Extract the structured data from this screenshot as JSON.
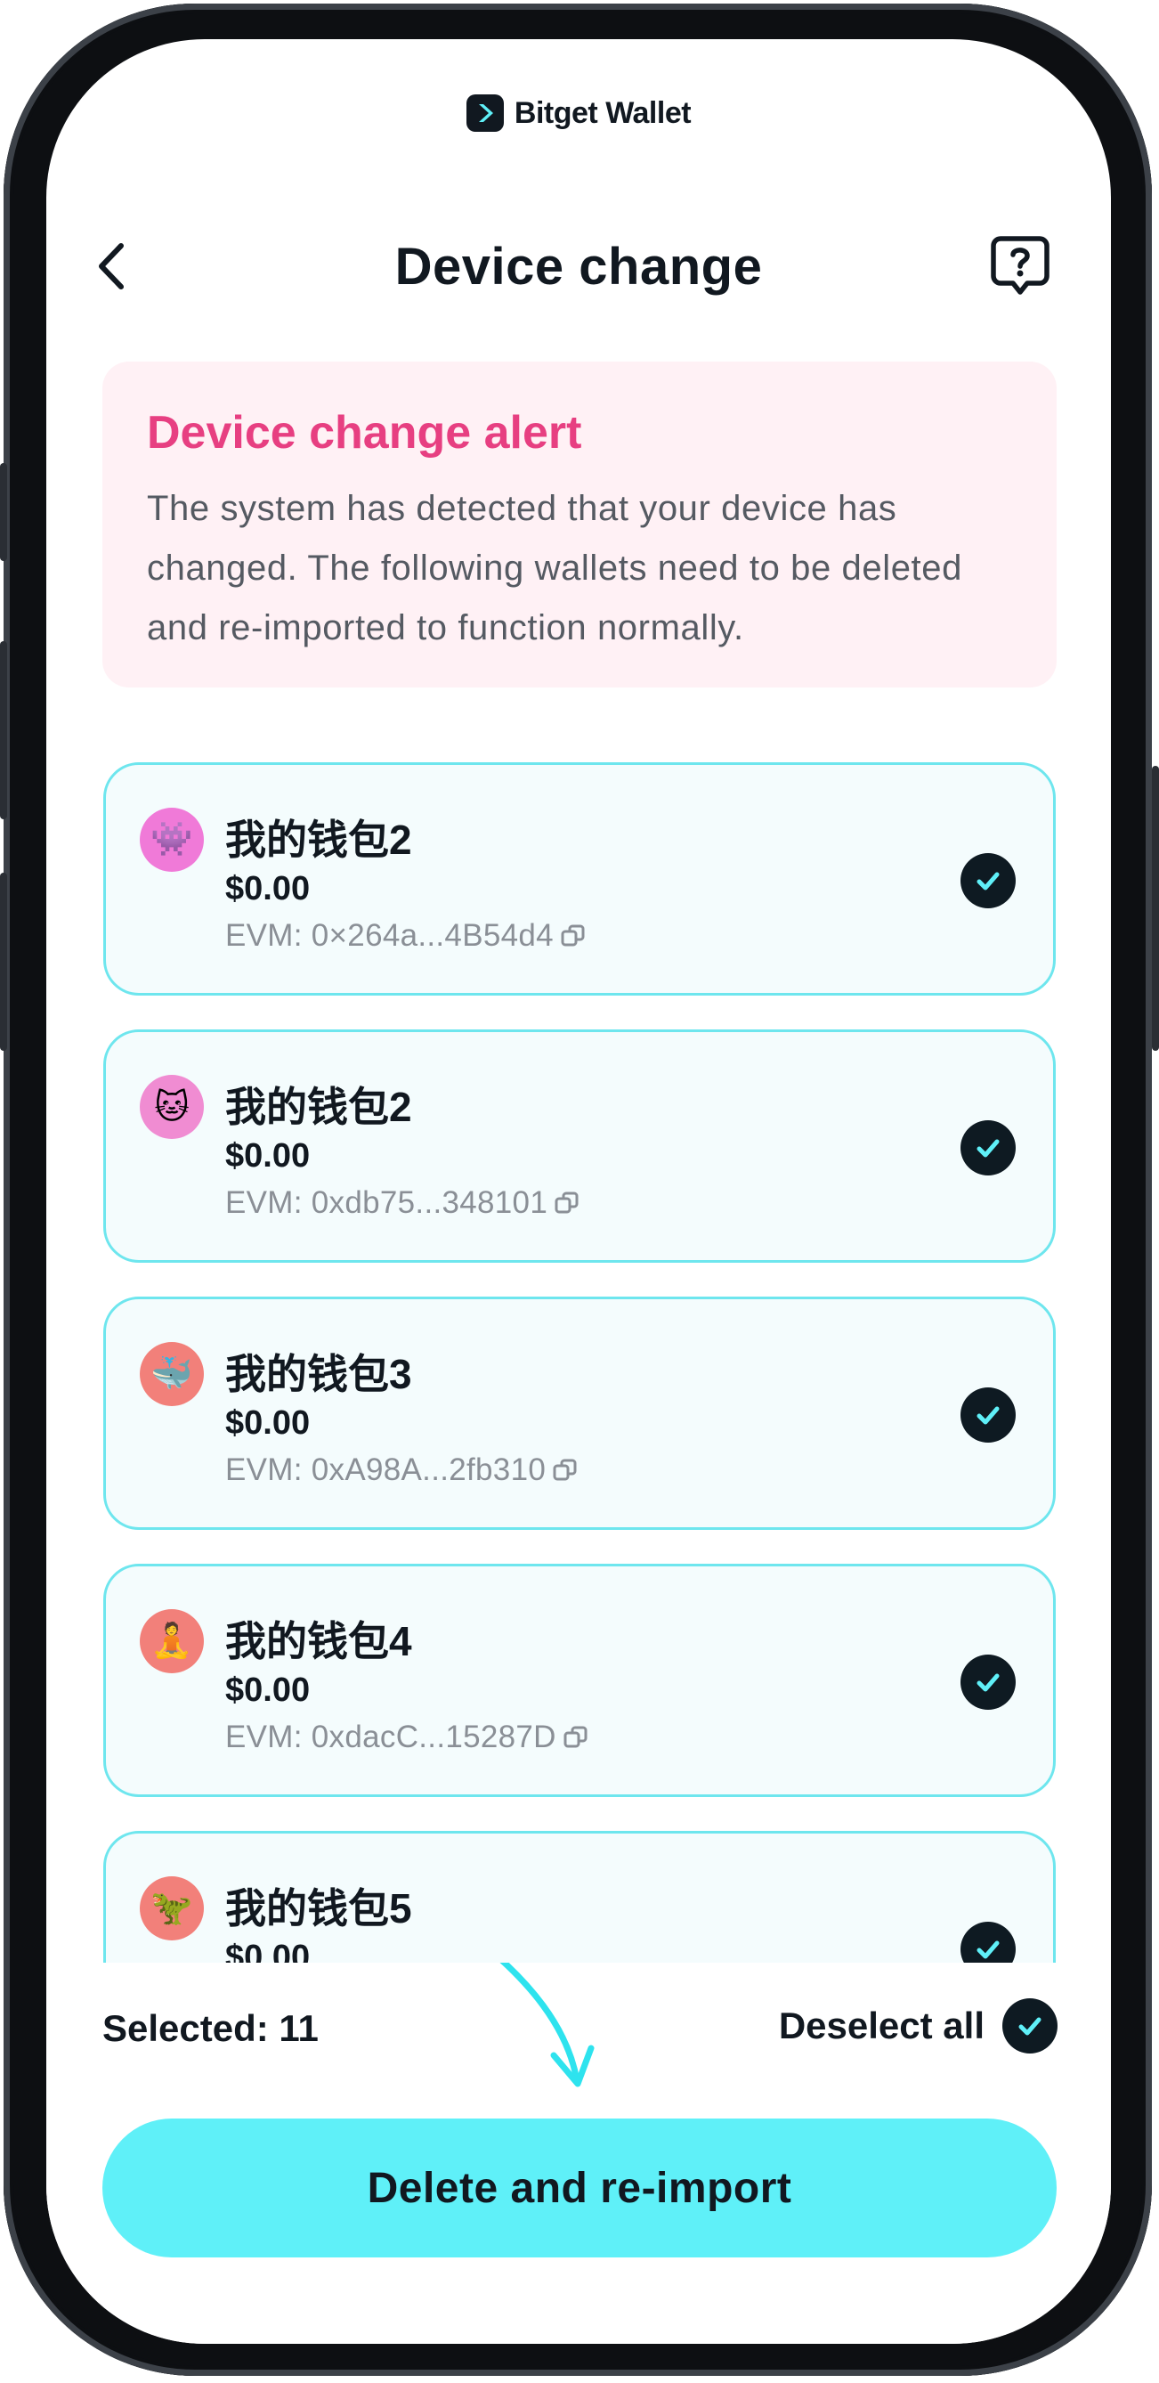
{
  "brand": {
    "name": "Bitget Wallet"
  },
  "header": {
    "title": "Device change",
    "back_icon": "chevron-left-icon",
    "help_icon": "help-bubble-icon"
  },
  "alert": {
    "title": "Device change alert",
    "message": "The system has detected that your device has changed. The following wallets need to be deleted and re-imported to function normally."
  },
  "wallets": [
    {
      "name": "我的钱包2",
      "balance": "$0.00",
      "address": "EVM: 0×264a...4B54d4",
      "avatar": "👾",
      "avatar_bg": "#f07ad8",
      "checked": true
    },
    {
      "name": "我的钱包2",
      "balance": "$0.00",
      "address": "EVM: 0xdb75...348101",
      "avatar": "🐱",
      "avatar_bg": "#f08cd2",
      "checked": true
    },
    {
      "name": "我的钱包3",
      "balance": "$0.00",
      "address": "EVM: 0xA98A...2fb310",
      "avatar": "🐳",
      "avatar_bg": "#f2807a",
      "checked": true
    },
    {
      "name": "我的钱包4",
      "balance": "$0.00",
      "address": "EVM: 0xdacC...15287D",
      "avatar": "🧘",
      "avatar_bg": "#f2807a",
      "checked": true
    },
    {
      "name": "我的钱包5",
      "balance": "$0.00",
      "address": "",
      "avatar": "🦖",
      "avatar_bg": "#f2807a",
      "checked": true
    }
  ],
  "footer": {
    "selected_label": "Selected: 11",
    "deselect_label": "Deselect all",
    "primary_button": "Delete and re-import"
  },
  "colors": {
    "accent": "#5ff0f8",
    "alert_title": "#e73f81",
    "alert_bg": "#fff1f5",
    "card_border": "#6ee6ee",
    "card_bg": "#f4fcfd",
    "check_bg": "#0e1a22"
  }
}
